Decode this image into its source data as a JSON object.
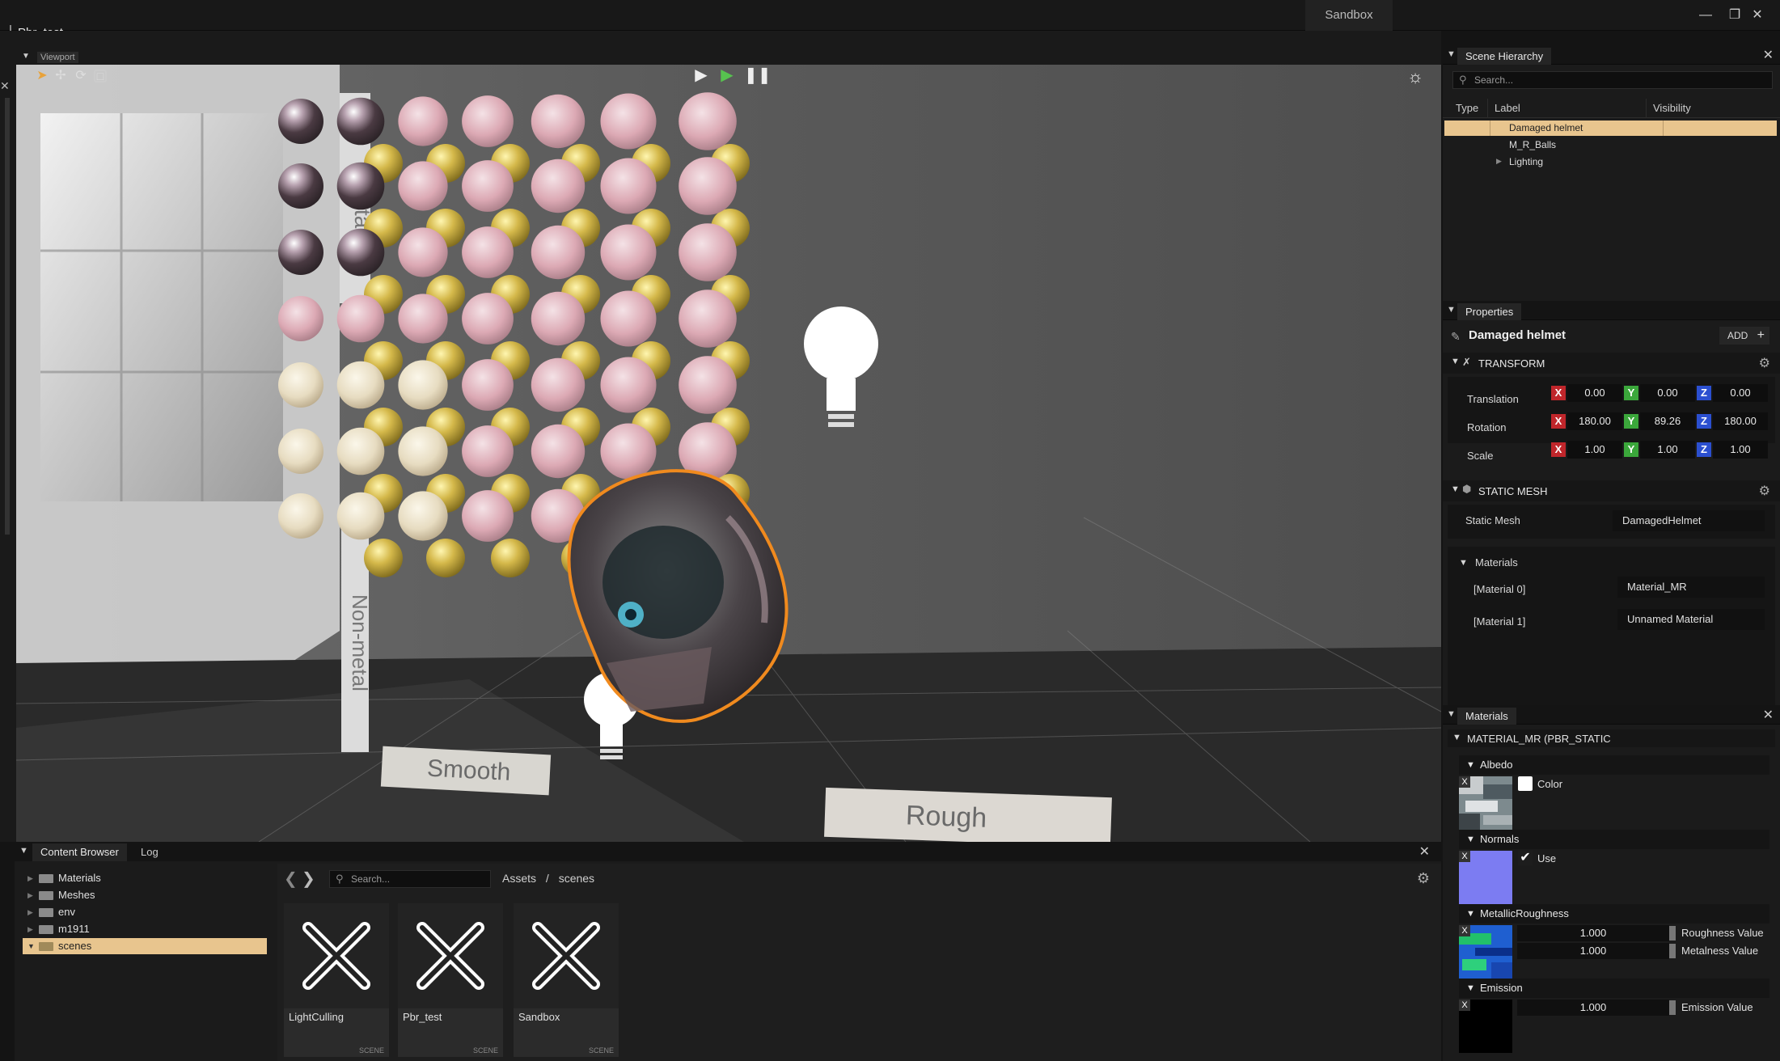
{
  "window": {
    "title": "Pbr_test",
    "tab": "Sandbox"
  },
  "viewport": {
    "tab_label": "Viewport",
    "labels": {
      "metal": "Metal",
      "nonmetal": "Non-metal",
      "smooth": "Smooth",
      "rough": "Rough"
    }
  },
  "scene_hierarchy": {
    "title": "Scene Hierarchy",
    "search_placeholder": "Search...",
    "columns": [
      "Type",
      "Label",
      "Visibility"
    ],
    "items": [
      {
        "label": "Damaged helmet",
        "selected": true
      },
      {
        "label": "M_R_Balls"
      },
      {
        "label": "Lighting"
      }
    ]
  },
  "properties": {
    "title": "Properties",
    "entity_name": "Damaged helmet",
    "add_label": "ADD",
    "transform": {
      "title": "TRANSFORM",
      "translation_label": "Translation",
      "rotation_label": "Rotation",
      "scale_label": "Scale",
      "translation": [
        "0.00",
        "0.00",
        "0.00"
      ],
      "rotation": [
        "180.00",
        "89.26",
        "180.00"
      ],
      "scale": [
        "1.00",
        "1.00",
        "1.00"
      ]
    },
    "static_mesh": {
      "title": "STATIC MESH",
      "mesh_label": "Static Mesh",
      "mesh_value": "DamagedHelmet",
      "materials_label": "Materials",
      "materials": [
        {
          "slot": "[Material 0]",
          "value": "Material_MR"
        },
        {
          "slot": "[Material 1]",
          "value": "Unnamed Material"
        }
      ]
    }
  },
  "materials_panel": {
    "title": "Materials",
    "material_name": "MATERIAL_MR (PBR_STATIC",
    "albedo": {
      "title": "Albedo",
      "color_label": "Color"
    },
    "normals": {
      "title": "Normals",
      "use_label": "Use"
    },
    "metallic_roughness": {
      "title": "MetallicRoughness",
      "roughness_value": "1.000",
      "roughness_label": "Roughness Value",
      "metalness_value": "1.000",
      "metalness_label": "Metalness Value"
    },
    "emission": {
      "title": "Emission",
      "value": "1.000",
      "label": "Emission Value"
    }
  },
  "content_browser": {
    "tab": "Content Browser",
    "log_tab": "Log",
    "search_placeholder": "Search...",
    "breadcrumb_root": "Assets",
    "breadcrumb_sep": "/",
    "breadcrumb_current": "scenes",
    "tree": [
      {
        "label": "Materials"
      },
      {
        "label": "Meshes"
      },
      {
        "label": "env"
      },
      {
        "label": "m1911"
      },
      {
        "label": "scenes",
        "selected": true
      }
    ],
    "assets": [
      {
        "name": "LightCulling",
        "kind": "SCENE"
      },
      {
        "name": "Pbr_test",
        "kind": "SCENE"
      },
      {
        "name": "Sandbox",
        "kind": "SCENE"
      }
    ]
  },
  "colors": {
    "selection": "#e8c58e",
    "axis_x": "#c0262b",
    "axis_y": "#3ba73b",
    "axis_z": "#2b4fd0",
    "normal_map": "#7c7cf2"
  }
}
